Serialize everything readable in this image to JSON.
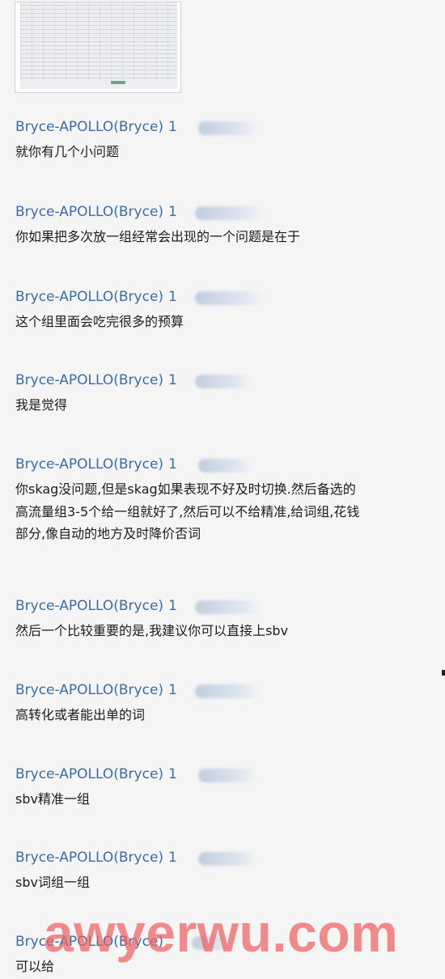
{
  "messages": [
    {
      "sender": "Bryce-APOLLO(Bryce)",
      "time": "1",
      "text": [
        "就你有几个小问题"
      ]
    },
    {
      "sender": "Bryce-APOLLO(Bryce)",
      "time": "1",
      "text": [
        "你如果把多次放一组经常会出现的一个问题是在于"
      ]
    },
    {
      "sender": "Bryce-APOLLO(Bryce)",
      "time": "1",
      "text": [
        "这个组里面会吃完很多的预算"
      ]
    },
    {
      "sender": "Bryce-APOLLO(Bryce)",
      "time": "1",
      "text": [
        "我是觉得"
      ]
    },
    {
      "sender": "Bryce-APOLLO(Bryce)",
      "time": "1",
      "text": [
        "你skag没问题,但是skag如果表现不好及时切换.然后备选的",
        "高流量组3-5个给一组就好了,然后可以不给精准,给词组,花钱",
        "部分,像自动的地方及时降价否词"
      ]
    },
    {
      "sender": "Bryce-APOLLO(Bryce)",
      "time": "1",
      "text": [
        "然后一个比较重要的是,我建议你可以直接上sbv"
      ]
    },
    {
      "sender": "Bryce-APOLLO(Bryce)",
      "time": "1",
      "text": [
        "高转化或者能出单的词"
      ]
    },
    {
      "sender": "Bryce-APOLLO(Bryce)",
      "time": "1",
      "text": [
        "sbv精准一组"
      ]
    },
    {
      "sender": "Bryce-APOLLO(Bryce)",
      "time": "1",
      "text": [
        "sbv词组一组"
      ]
    },
    {
      "sender": "Bryce-APOLLO(Bryce)",
      "time": "",
      "text": [
        "可以给"
      ]
    }
  ],
  "watermark": "awyerwu.com"
}
